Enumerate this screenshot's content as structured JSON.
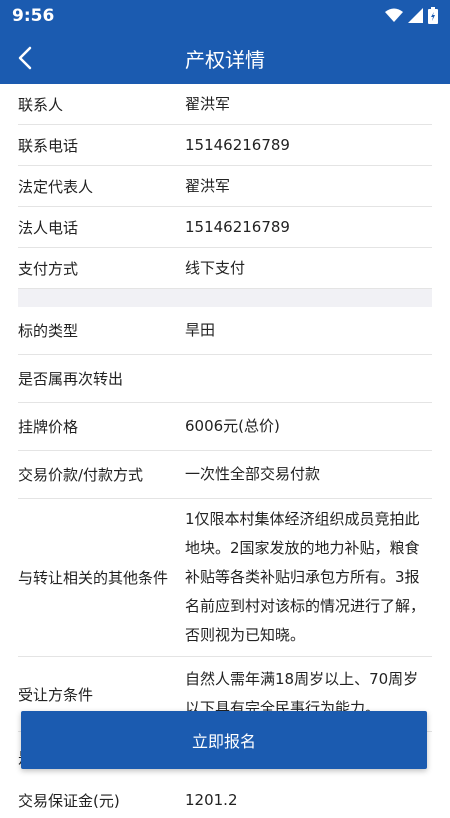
{
  "status_bar": {
    "time": "9:56"
  },
  "header": {
    "title": "产权详情"
  },
  "rows_top": [
    {
      "label": "联系人",
      "value": "翟洪军"
    },
    {
      "label": "联系电话",
      "value": "15146216789"
    },
    {
      "label": "法定代表人",
      "value": "翟洪军"
    },
    {
      "label": "法人电话",
      "value": "15146216789"
    },
    {
      "label": "支付方式",
      "value": "线下支付"
    }
  ],
  "rows_bottom": [
    {
      "label": "标的类型",
      "value": "旱田"
    },
    {
      "label": "是否属再次转出",
      "value": ""
    },
    {
      "label": "挂牌价格",
      "value": "6006元(总价)"
    },
    {
      "label": "交易价款/付款方式",
      "value": "一次性全部交易付款"
    },
    {
      "label": "与转让相关的其他条件",
      "value": "1仅限本村集体经济组织成员竞拍此地块。2国家发放的地力补贴，粮食补贴等各类补贴归承包方所有。3报名前应到村对该标的情况进行了解，否则视为已知晓。"
    },
    {
      "label": "受让方条件",
      "value": "自然人需年满18周岁以上、70周岁以下具有完全民事行为能力。"
    },
    {
      "label": "交易保证金(元)",
      "value": "1201.2"
    }
  ],
  "partial_label": "是",
  "action_button": {
    "label": "立即报名"
  },
  "colors": {
    "primary": "#1b5bb0",
    "divider": "#e4e4e4",
    "section_gap": "#f1f1f5"
  },
  "icons": {
    "back": "chevron-left-icon",
    "wifi": "wifi-icon",
    "signal": "signal-icon",
    "battery": "battery-icon"
  }
}
